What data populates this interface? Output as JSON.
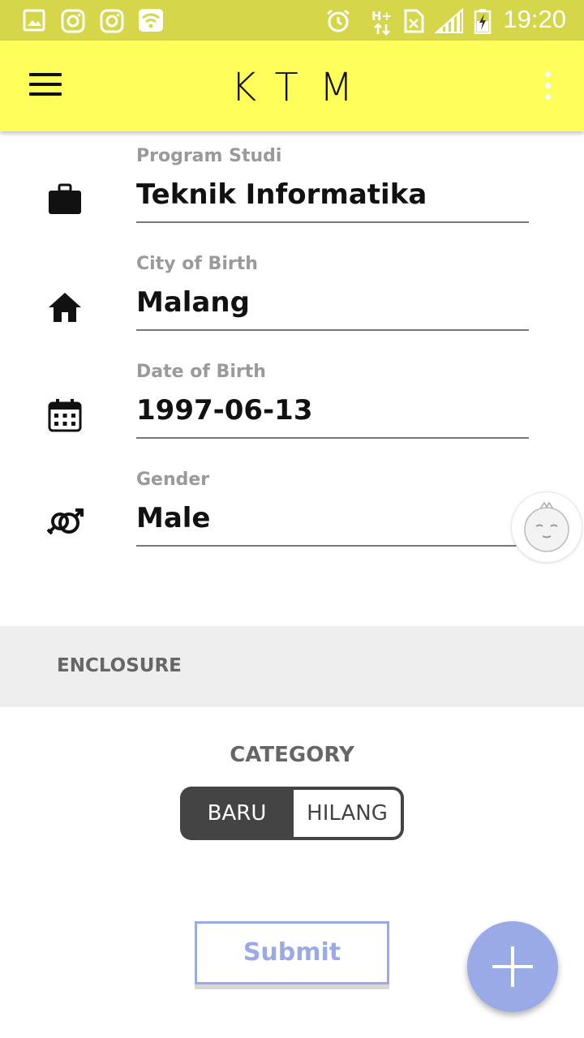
{
  "status_bar": {
    "time": "19:20",
    "icons": [
      "gallery-icon",
      "instagram-icon",
      "instagram-icon",
      "wifi-icon",
      "alarm-icon",
      "hplus-data-icon",
      "no-sim-icon",
      "signal-icon",
      "battery-charging-icon"
    ]
  },
  "app_bar": {
    "title": "KTM",
    "menu_icon": "hamburger-menu-icon",
    "overflow_icon": "more-vertical-icon"
  },
  "form": {
    "fields": [
      {
        "label": "Program Studi",
        "value": "Teknik Informatika",
        "icon": "briefcase-icon"
      },
      {
        "label": "City of Birth",
        "value": "Malang",
        "icon": "home-icon"
      },
      {
        "label": "Date of Birth",
        "value": "1997-06-13",
        "icon": "calendar-icon"
      },
      {
        "label": "Gender",
        "value": "Male",
        "icon": "gender-icon"
      }
    ]
  },
  "enclosure": {
    "label": "ENCLOSURE"
  },
  "category": {
    "label": "CATEGORY",
    "options": [
      "BARU",
      "HILANG"
    ],
    "selected": "BARU"
  },
  "submit": {
    "label": "Submit"
  },
  "fab": {
    "icon": "plus-icon"
  },
  "colors": {
    "status_bar": "#d6d64a",
    "app_bar": "#ffff5c",
    "accent": "#9aaae6",
    "toggle_dark": "#444444"
  }
}
